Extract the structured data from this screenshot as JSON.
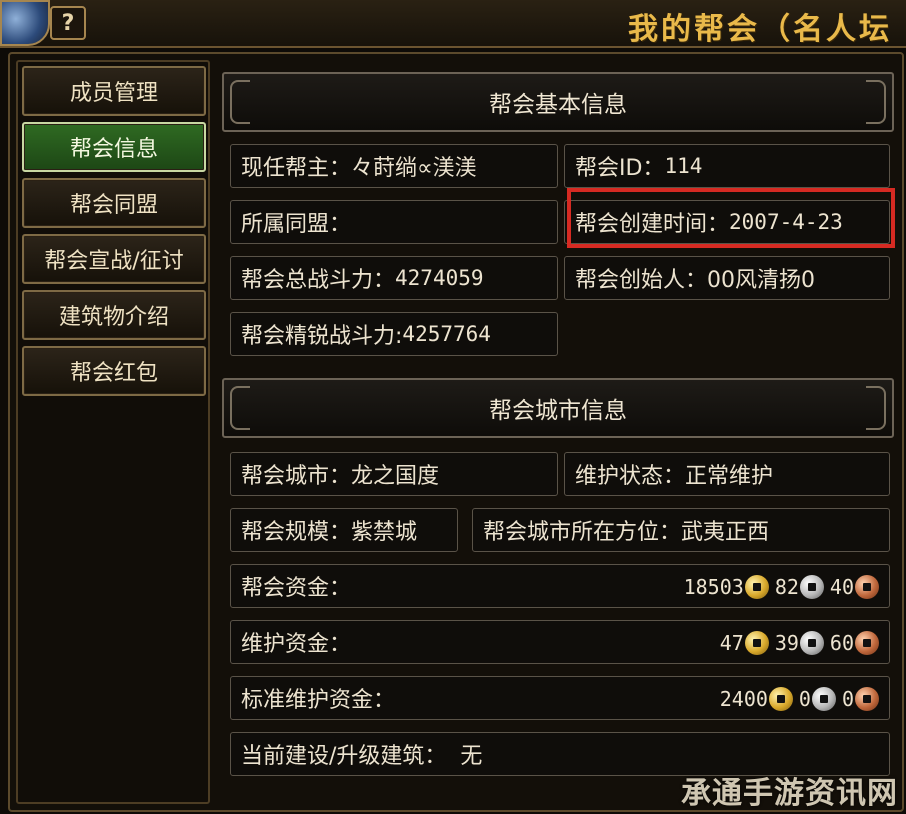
{
  "window": {
    "title": "我的帮会（名人坛",
    "help_label": "?"
  },
  "sidebar": {
    "items": [
      {
        "label": "成员管理",
        "active": false
      },
      {
        "label": "帮会信息",
        "active": true
      },
      {
        "label": "帮会同盟",
        "active": false
      },
      {
        "label": "帮会宣战/征讨",
        "active": false
      },
      {
        "label": "建筑物介绍",
        "active": false
      },
      {
        "label": "帮会红包",
        "active": false
      }
    ]
  },
  "basic": {
    "header": "帮会基本信息",
    "leader_label": "现任帮主：",
    "leader_value": "々莳绱∝渼渼",
    "guild_id_label": "帮会ID：",
    "guild_id_value": "114",
    "alliance_label": "所属同盟：",
    "alliance_value": "",
    "created_label": "帮会创建时间：",
    "created_value": "2007-4-23",
    "total_power_label": "帮会总战斗力：",
    "total_power_value": "4274059",
    "founder_label": "帮会创始人：",
    "founder_value": "00风清扬0",
    "elite_power_label": "帮会精锐战斗力:",
    "elite_power_value": "4257764"
  },
  "city": {
    "header": "帮会城市信息",
    "city_label": "帮会城市：",
    "city_value": "龙之国度",
    "maintain_label": "维护状态：",
    "maintain_value": "正常维护",
    "scale_label": "帮会规模：",
    "scale_value": "紫禁城",
    "location_label": "帮会城市所在方位：",
    "location_value": "武夷正西",
    "funds_label": "帮会资金：",
    "funds": {
      "gold": "18503",
      "silver": "82",
      "copper": "40"
    },
    "maint_funds_label": "维护资金：",
    "maint_funds": {
      "gold": "47",
      "silver": "39",
      "copper": "60"
    },
    "std_funds_label": "标准维护资金：",
    "std_funds": {
      "gold": "2400",
      "silver": "0",
      "copper": "0"
    },
    "building_label": "当前建设/升级建筑：",
    "building_value": "无"
  },
  "icons": {
    "coin_gold": "gold-coin-icon",
    "coin_silver": "silver-coin-icon",
    "coin_copper": "copper-coin-icon"
  },
  "colors": {
    "highlight": "#d62a22",
    "active_tab": "#2f6a22",
    "title_gold": "#e9b94a"
  },
  "watermark": "承通手游资讯网"
}
